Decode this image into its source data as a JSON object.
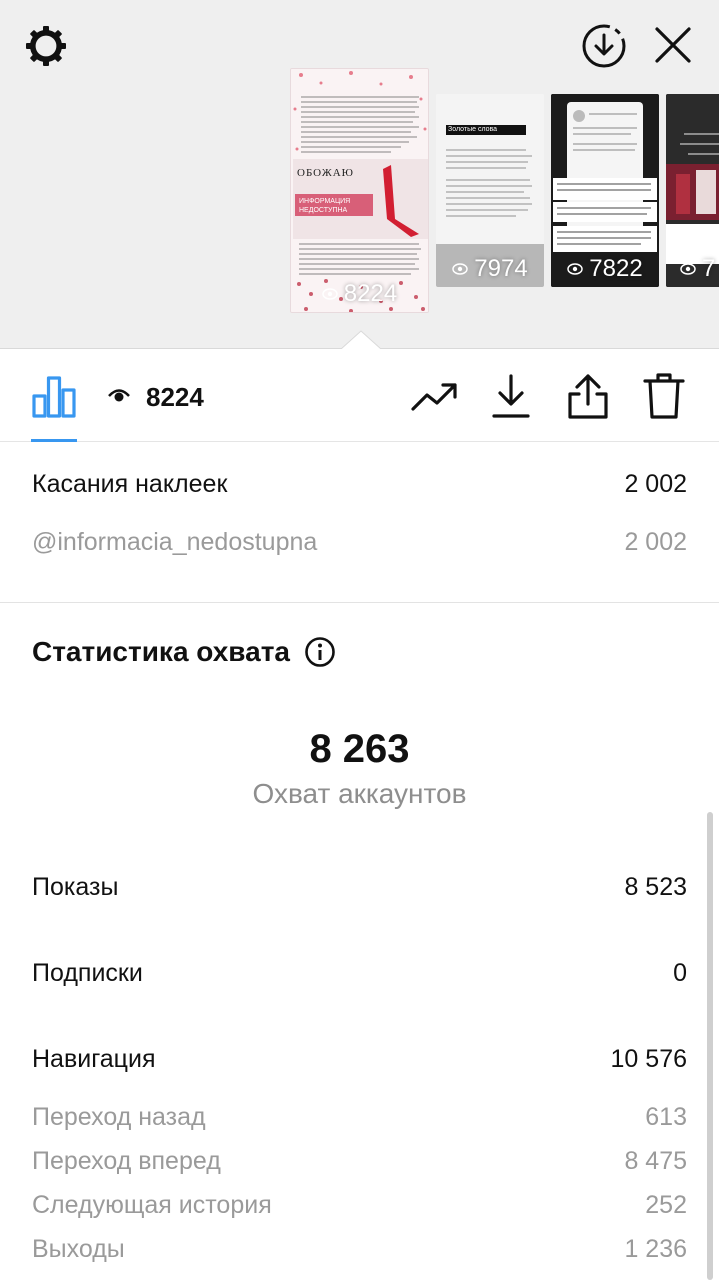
{
  "header": {
    "settings_icon": "gear-icon",
    "download_icon": "download-circle-icon",
    "close_icon": "close-icon"
  },
  "stories": [
    {
      "views": "8224",
      "title": "ОБОЖАЮ",
      "subtitle": "ИНФОРМАЦИЯ НЕДОСТУПНА"
    },
    {
      "views": "7974",
      "heading": "Золотые слова"
    },
    {
      "views": "7822"
    },
    {
      "views": "7"
    }
  ],
  "toolbar": {
    "views": "8224",
    "icons": [
      "bar-chart-icon",
      "eye-icon",
      "trending-icon",
      "download-icon",
      "share-icon",
      "trash-icon"
    ]
  },
  "stickers": {
    "label": "Касания наклеек",
    "value": "2 002",
    "mention_label": "@informacia_nedostupna",
    "mention_value": "2 002"
  },
  "reach": {
    "title": "Статистика охвата",
    "info_icon": "info-icon",
    "accounts_value": "8 263",
    "accounts_label": "Охват аккаунтов",
    "impressions_label": "Показы",
    "impressions_value": "8 523",
    "follows_label": "Подписки",
    "follows_value": "0",
    "navigation_label": "Навигация",
    "navigation_value": "10 576",
    "back_label": "Переход назад",
    "back_value": "613",
    "forward_label": "Переход вперед",
    "forward_value": "8 475",
    "next_label": "Следующая история",
    "next_value": "252",
    "exits_label": "Выходы",
    "exits_value": "1 236"
  },
  "colors": {
    "accent": "#3897f0",
    "top_bg": "#efefef",
    "grey_text": "#9a9a9a"
  }
}
